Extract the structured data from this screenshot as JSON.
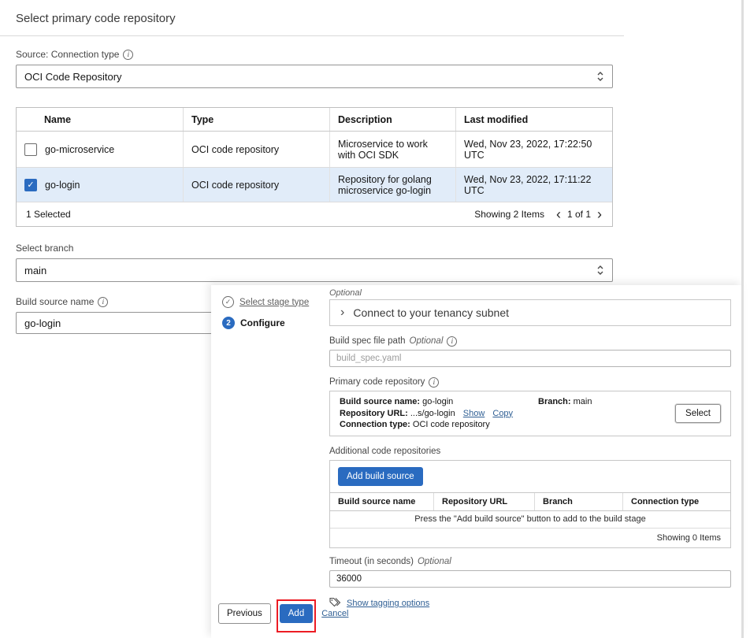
{
  "colors": {
    "accent": "#2a6bc0",
    "link": "#2f5f94",
    "selected_row": "#e1ecf9",
    "annotation": "#ec1c24"
  },
  "icons": {
    "info": "i",
    "check": "✓",
    "chevron_left": "‹",
    "chevron_right": "›"
  },
  "dialog": {
    "title": "Select primary code repository",
    "source_label": "Source: Connection type",
    "source_value": "OCI Code Repository",
    "table": {
      "columns": [
        "Name",
        "Type",
        "Description",
        "Last modified"
      ],
      "rows": [
        {
          "name": "go-microservice",
          "type": "OCI code repository",
          "description": "Microservice to work with OCI SDK",
          "last_modified": "Wed, Nov 23, 2022, 17:22:50 UTC"
        },
        {
          "name": "go-login",
          "type": "OCI code repository",
          "description": "Repository for golang microservice go-login",
          "last_modified": "Wed, Nov 23, 2022, 17:11:22 UTC"
        }
      ],
      "selected_count": "1 Selected",
      "showing": "Showing 2 Items",
      "page": "1 of 1"
    },
    "branch_label": "Select branch",
    "branch_value": "main",
    "build_source_label": "Build source name",
    "build_source_value": "go-login"
  },
  "wizard": {
    "steps": {
      "step1": "Select stage type",
      "step2": "Configure",
      "step2_number": "2"
    },
    "optional": "Optional",
    "subnet_title": "Connect to your tenancy subnet",
    "build_spec_label": "Build spec file path",
    "build_spec_optional": "Optional",
    "build_spec_placeholder": "build_spec.yaml",
    "primary_repo": {
      "label": "Primary code repository",
      "build_source_name_label": "Build source name:",
      "build_source_name_value": "go-login",
      "branch_label": "Branch:",
      "branch_value": "main",
      "repo_url_label": "Repository URL:",
      "repo_url_value": "...s/go-login",
      "show_link": "Show",
      "copy_link": "Copy",
      "connection_label": "Connection type:",
      "connection_value": "OCI code repository",
      "select_button": "Select"
    },
    "additional": {
      "label": "Additional code repositories",
      "add_button": "Add build source",
      "columns": [
        "Build source name",
        "Repository URL",
        "Branch",
        "Connection type"
      ],
      "empty_text": "Press the \"Add build source\" button to add to the build stage",
      "showing": "Showing 0 Items"
    },
    "timeout_label": "Timeout (in seconds)",
    "timeout_optional": "Optional",
    "timeout_value": "36000",
    "tagging_link": "Show tagging options",
    "footer": {
      "previous": "Previous",
      "add": "Add",
      "cancel": "Cancel"
    }
  }
}
